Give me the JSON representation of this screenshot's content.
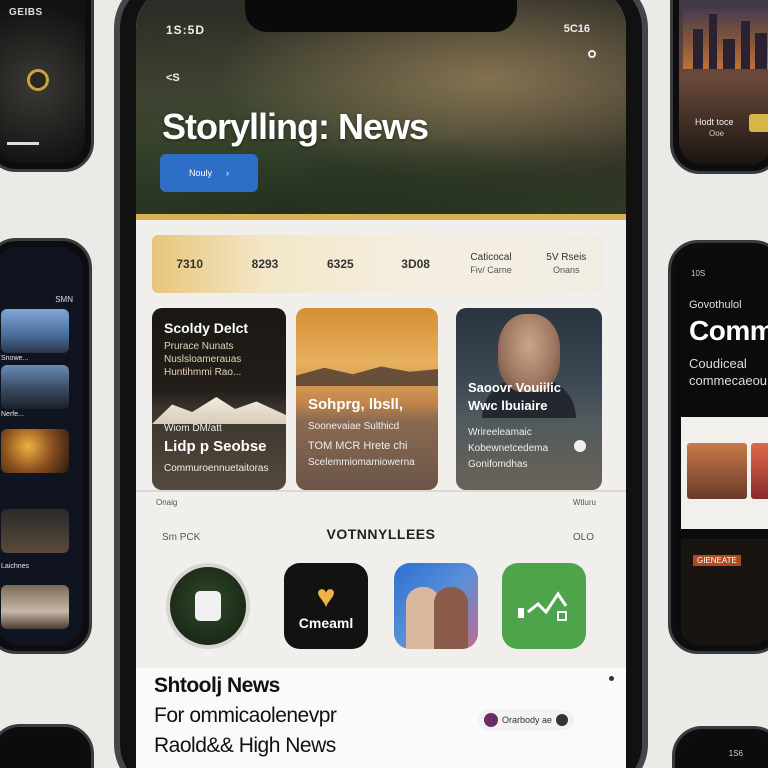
{
  "left_phones": {
    "top_label": "GEIBS",
    "middle_time": "SMN",
    "tiles": [
      {
        "caption": "Snowe..."
      },
      {
        "caption": "Nerfe..."
      },
      {
        "caption": ""
      },
      {
        "caption": "Laichnes"
      },
      {
        "caption": ""
      }
    ]
  },
  "right_phones": {
    "top_label": "Hodt toce",
    "top_sub": "Ooe",
    "middle_time": "10S",
    "middle_kicker": "Govothulol",
    "middle_title": "Comm",
    "middle_sub_1": "Coudiceal",
    "middle_sub_2": "commecaeou",
    "middle_badge": "GIENEATE",
    "bottom_time": "1S6"
  },
  "status": {
    "time": "1S:5D",
    "right": "5C16"
  },
  "hero": {
    "back": "<S",
    "title": "Storylling: News",
    "button_label": "Nouly",
    "button_arrow": "›"
  },
  "stats": [
    {
      "value": "7310"
    },
    {
      "value": "8293"
    },
    {
      "value": "6325"
    },
    {
      "value": "3D08"
    },
    {
      "value": "Caticocal",
      "sub": "Fiv/ Carne"
    },
    {
      "value": "5V Rseis",
      "sub": "Onans"
    }
  ],
  "cards": [
    {
      "title": "Scoldy Delct",
      "meta": [
        "Prurace Nunats",
        "Nuslsloamerauas",
        "Huntihmmi Rao..."
      ],
      "mid": "Wiom DM/att",
      "big": "Lidp p Seobse",
      "foot": "Commuroennuetaitoras"
    },
    {
      "title": "Sohprg, lbsll,",
      "meta": [
        "Soonevaiae Sulthicd"
      ],
      "big": "",
      "foot_1": "TOM MCR Hrete chi",
      "foot_2": "Scelemmiomamiowerna"
    },
    {
      "title": "Saoovr Vouiilic",
      "meta": [
        "Wwc lbuiaire"
      ],
      "big": "",
      "foot_1": "Wrireeleamaic",
      "foot_2": "Kobewnetcedema",
      "foot_3": "Gonifomdhas"
    }
  ],
  "under_labels": {
    "left": "Onaig",
    "right": "Wtluru"
  },
  "section": {
    "left": "Sm PCK",
    "title": "VOTNNYLLEES",
    "right": "OLO"
  },
  "apps": [
    {
      "name": "app-circle",
      "label": ""
    },
    {
      "name": "app-cmeml",
      "label": "Cmeaml"
    },
    {
      "name": "app-couple",
      "label": ""
    },
    {
      "name": "app-chart",
      "label": ""
    }
  ],
  "footer": {
    "line_1": "Shtoolj News",
    "line_2": "For ommicaolenevpr",
    "line_3": "Raold&& High News",
    "pill_text": "Orarbody ae"
  }
}
